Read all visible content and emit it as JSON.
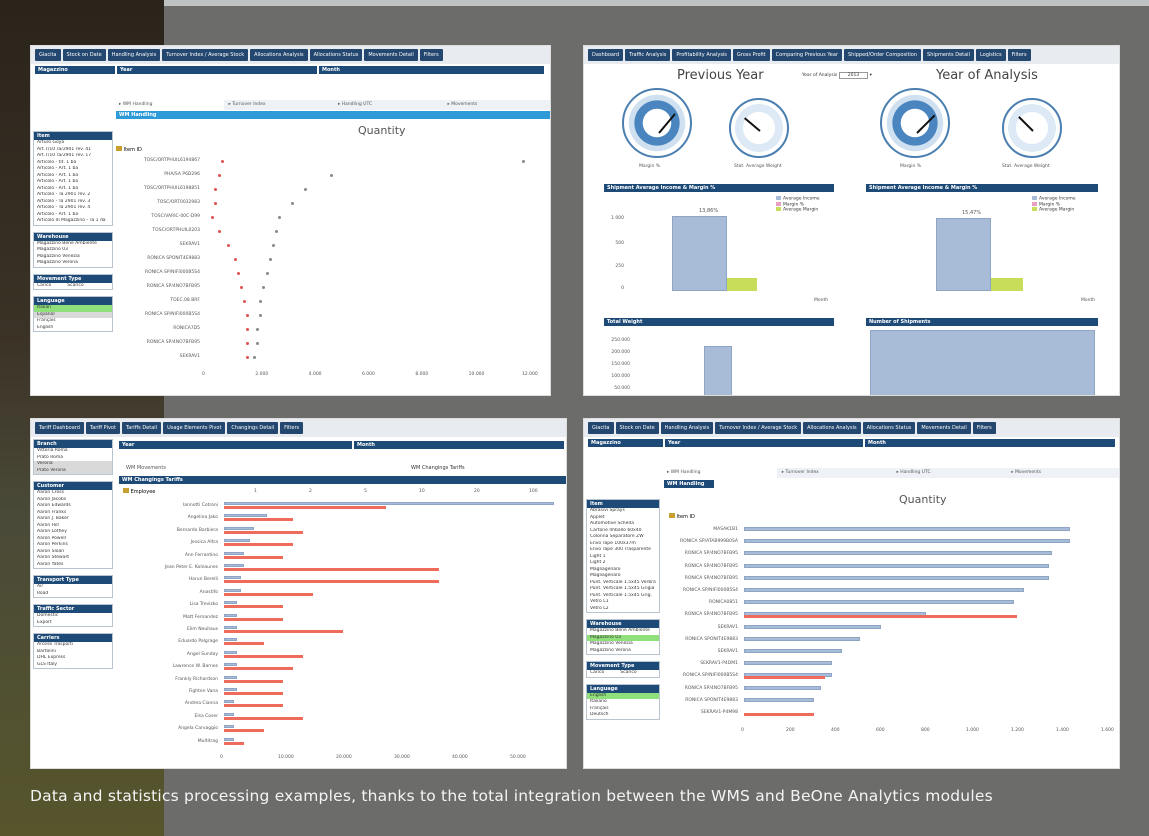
{
  "caption": "Data and statistics processing examples, thanks to the total integration between the WMS and BeOne Analytics modules",
  "colors": {
    "accent": "#1d4a77",
    "bar_blue": "#a8bcd8",
    "bar_red": "#ef6b5b",
    "green": "#c8de5a"
  },
  "panel1": {
    "tabs": [
      "Giacita",
      "Stock on Date",
      "Handling Analysis",
      "Turnover Index / Average Stock",
      "Allocations Analysis",
      "Allocations Status",
      "Movements Detail",
      "Filters"
    ],
    "header_left": "Magazzino",
    "header_year": "Year",
    "header_month": "Month",
    "subtabs": [
      "WM Handling",
      "Turnover Index",
      "Handling UTC",
      "Movements"
    ],
    "chart_header": "WM Handling",
    "chart_title": "Quantity",
    "item_label": "Item ID",
    "items": [
      "TOSC/ORTPHUIL6194867",
      "PHA/SA P6D296",
      "TOSC/ORTPHUIL6198851",
      "TOSC/ORT0032983",
      "TOSC/VARIC-00C-D99",
      "TOSC/ORTPHUIL0203",
      "SEKRAV1",
      "RONICA SPONIT4E9883",
      "RONICA SP/NIFI000B5S4",
      "RONICA SP/4NO7BFB95",
      "TOEC.08.BRF",
      "RONICA SP/NIFI000B5S4",
      "RONICA7D5",
      "RONICA SP/4NO7BFB95",
      "SEKRAV1"
    ],
    "x_ticks": [
      "0",
      "2.000",
      "4.000",
      "6.000",
      "8.000",
      "10.000",
      "12.000"
    ],
    "side_item_header": "Item",
    "side_items": [
      "Arturo Goya",
      "Art.T/10 Ta/2901 rev. 41",
      "Art.T/10 Ta/2901 rev. 17",
      "Articolo - tit. 1 ba",
      "Articolo - Art. 1 ba",
      "Articolo - Art. 1 ba",
      "Articolo - Art. 1 ba",
      "Articolo - Art. 1 ba",
      "Articolo - Ta 2901 rev. 2",
      "Articolo - Ta 2901 rev. 3",
      "Articolo - Ta 2901 rev. 4",
      "Articolo - Art. 1 ba",
      "Articolo di Magazzino - Ta 1 da"
    ],
    "warehouse_header": "Warehouse",
    "warehouse_items": [
      "Magazzino Bene Ambiente",
      "Magazzino 03",
      "Magazzino Venezia",
      "Magazzino Verona"
    ],
    "movement_header": "Movement Type",
    "movement_items": [
      "Carico",
      "Scarico"
    ],
    "language_header": "Language",
    "language_items": [
      "Italian",
      "Espanol",
      "Français",
      "English"
    ]
  },
  "panel2": {
    "tabs": [
      "Dashboard",
      "Traffic Analysis",
      "Profitability Analysis",
      "Gross Profit",
      "Comparing Previous Year",
      "Shipped/Order Composition",
      "Shipments Detail",
      "Logistics",
      "Filters"
    ],
    "prev_year": "Previous Year",
    "year_analysis": "Year of Analysis",
    "year_selector_label": "Year of Analysis",
    "year_value": "2013",
    "gauge_labels": [
      "Margin %",
      "Stat. Average Weight",
      "Margin %",
      "Stat. Average Weight"
    ],
    "chart1_header": "Shipment Average Income & Margin %",
    "chart2_header": "Shipment Average Income & Margin %",
    "bar_pct1": "13,86%",
    "bar_pct2": "15,47%",
    "legend": [
      "Average Income",
      "Margin %",
      "Average Margin"
    ],
    "y_ticks": [
      "1.000",
      "500",
      "250",
      "0"
    ],
    "x_label": "Month",
    "bottom_left_header": "Total Weight",
    "bottom_right_header": "Number of Shipments",
    "bl_y_ticks": [
      "250.000",
      "200.000",
      "150.000",
      "100.000",
      "50.000"
    ]
  },
  "panel3": {
    "tabs": [
      "Tariff Dashboard",
      "Tariff Pivot",
      "Tariffs Detail",
      "Usage Elements Pivot",
      "Changings Detail",
      "Filters"
    ],
    "header_year": "Year",
    "header_month": "Month",
    "chart_header": "WM Changings Tariffs",
    "employee_label": "Employee",
    "side_search": "Branch",
    "names": [
      "Iannotti Cotroni",
      "Angelina Jako",
      "Bernardo Barbiera",
      "Jessica Altra",
      "Ann Ferrantino",
      "Jean Peter E. Kolnaunes",
      "Harun Berelli",
      "Anastifo",
      "Lisa Trevizko",
      "Matt Fernandez",
      "Elim Neuhaus",
      "Eduardo Palgrage",
      "Angel Sunday",
      "Lawrence W. Barnes",
      "Frankly Richardson",
      "Fighten Vana",
      "Andrea Cianna",
      "Elsa Coser",
      "Angela Carvaggio",
      "Multitrag"
    ],
    "x_ticks": [
      "0",
      "10.000",
      "20.000",
      "30.000",
      "40.000",
      "50.000"
    ],
    "top_ticks": [
      "1",
      "2",
      "5",
      "10",
      "20",
      "100"
    ],
    "side_customer_header": "Customer",
    "side_transport_header": "Transport Type",
    "side_traffic_header": "Traffic Sector",
    "side_carriers_header": "Carriers"
  },
  "panel4": {
    "tabs": [
      "Giacita",
      "Stock on Date",
      "Handling Analysis",
      "Turnover Index / Average Stock",
      "Allocations Analysis",
      "Allocations Status",
      "Movements Detail",
      "Filters"
    ],
    "header_left": "Magazzino",
    "header_year": "Year",
    "header_month": "Month",
    "subtabs": [
      "WM Handling",
      "Turnover Index",
      "Handling UTC",
      "Movements"
    ],
    "chart_header": "WM Handling",
    "chart_title": "Quantity",
    "item_label": "Item ID",
    "items": [
      "MASAK1B1",
      "RONICA SP/ATAB999B0SA",
      "RONICA SP/4NO7BFB95",
      "RONICA SP/4NO7BFB95",
      "RONICA SP/4NO7BFB95",
      "RONICA SP/NIFI000B5S4",
      "RONICA0851",
      "RONICA SP/4NO7BFB95",
      "SEKRAV1",
      "RONICA SPONIT4E9883",
      "SEKRAV1",
      "SEKRAV1-P4DM1",
      "RONICA SP/NIFI000B5S4",
      "RONICA SP/4NO7BFB95",
      "RONICA SPONIT4E9883",
      "SEKRAV1-P4M98"
    ],
    "x_ticks": [
      "0",
      "200",
      "400",
      "600",
      "800",
      "1.000",
      "1.200",
      "1.400",
      "1.600"
    ],
    "warehouse_header": "Warehouse",
    "warehouse_items": [
      "Magazzino Bene Ambiente",
      "Magazzino 03",
      "Magazzino Venezia",
      "Magazzino Verona"
    ],
    "movement_header": "Movement Type",
    "movement_items": [
      "Carico",
      "Scarico"
    ],
    "language_header": "Language",
    "language_items": [
      "English",
      "Italiano",
      "Français",
      "Deutsch"
    ]
  }
}
